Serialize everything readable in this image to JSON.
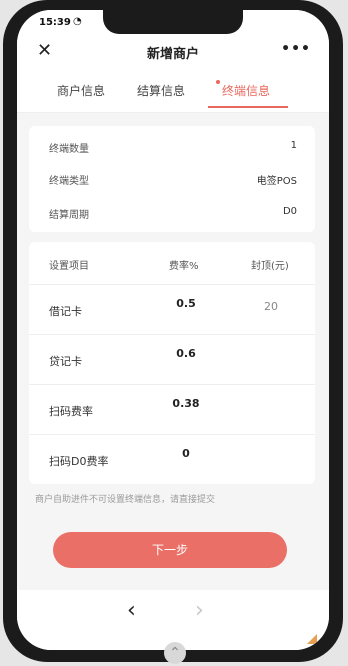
{
  "status": {
    "time": "15:39",
    "wifi_icon": "wifi-icon"
  },
  "nav": {
    "title": "新增商户",
    "close_icon": "close-icon",
    "more_icon": "more-icon"
  },
  "tabs": [
    {
      "label": "商户信息",
      "active": false
    },
    {
      "label": "结算信息",
      "active": false
    },
    {
      "label": "终端信息",
      "active": true
    }
  ],
  "terminal": [
    {
      "label": "终端数量",
      "value": "1"
    },
    {
      "label": "终端类型",
      "value": "电签POS"
    },
    {
      "label": "结算周期",
      "value": "D0"
    }
  ],
  "rates": {
    "headers": {
      "item": "设置项目",
      "rate": "费率%",
      "cap": "封顶(元)"
    },
    "rows": [
      {
        "name": "借记卡",
        "rate": "0.5",
        "cap": "20"
      },
      {
        "name": "贷记卡",
        "rate": "0.6",
        "cap": ""
      },
      {
        "name": "扫码费率",
        "rate": "0.38",
        "cap": ""
      },
      {
        "name": "扫码D0费率",
        "rate": "0",
        "cap": ""
      }
    ]
  },
  "note": "商户自助进件不可设置终端信息，请直接提交",
  "next_label": "下一步",
  "bottom": {
    "back_icon": "back-icon",
    "forward_icon": "forward-icon"
  },
  "colors": {
    "accent": "#e8685e",
    "button": "#ea6f66"
  }
}
